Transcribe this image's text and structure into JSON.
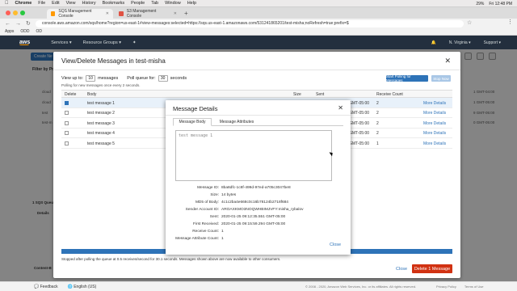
{
  "menubar": {
    "apple": "",
    "items": [
      "Chrome",
      "File",
      "Edit",
      "View",
      "History",
      "Bookmarks",
      "People",
      "Tab",
      "Window",
      "Help"
    ],
    "battery": "29%",
    "clock": "Fri 12:48 PM"
  },
  "tabs": [
    {
      "label": "SQS Management Console",
      "active": true
    },
    {
      "label": "S3 Management Console",
      "active": false
    }
  ],
  "address": {
    "url": "console.aws.amazon.com/sqs/home?region=us-east-1#view-messages:selected=https://sqs.us-east-1.amazonaws.com/531241865201/test-misha;noRefresh=true;prefix=$"
  },
  "bookmarks": [
    "Apps",
    "ODD",
    "OD"
  ],
  "awsnav": {
    "logo": "aws",
    "services": "Services ▾",
    "resource_groups": "Resource Groups ▾",
    "region": "N. Virginia ▾",
    "support": "Support ▾"
  },
  "bgpage": {
    "create_button": "Create Ne",
    "filter": "Filter by Pr",
    "rows": [
      "cloud",
      "cloud",
      "test",
      "test-m"
    ],
    "dates": [
      "1 GMT-04:00",
      "1 GMT-05:00",
      "9 GMT-05:00",
      "0 GMT-05:00"
    ],
    "selected": "1 SQS Queue",
    "details": "Details",
    "content": "Content-B"
  },
  "main_modal": {
    "title": "View/Delete Messages in test-misha",
    "view_up_to": "View up to:",
    "view_up_to_value": "10",
    "messages": "messages",
    "poll_queue": "Poll queue for:",
    "poll_value": "30",
    "seconds": "seconds",
    "poll_note": "Polling for new messages once every 2 seconds.",
    "start_button": "Start Polling for Messages",
    "stop_button": "Stop Now",
    "headers": {
      "delete": "Delete",
      "body": "Body",
      "size": "Size",
      "sent": "Sent",
      "receive_count": "Receive Count"
    },
    "rows": [
      {
        "body": "test message 1",
        "sent": "GMT-05:00",
        "count": "2",
        "link": "More Details",
        "checked": true
      },
      {
        "body": "test message 2",
        "sent": "GMT-05:00",
        "count": "2",
        "link": "More Details",
        "checked": false
      },
      {
        "body": "test message 3",
        "sent": "GMT-05:00",
        "count": "2",
        "link": "More Details",
        "checked": false
      },
      {
        "body": "test message 4",
        "sent": "GMT-05:00",
        "count": "2",
        "link": "More Details",
        "checked": false
      },
      {
        "body": "test message 5",
        "sent": "GMT-05:00",
        "count": "1",
        "link": "More Details",
        "checked": false
      }
    ],
    "stopped_note": "Stopped after polling the queue at 0.5 receives/second for 30.1 seconds. Messages shown above are now available to other consumers.",
    "close": "Close",
    "delete_button": "Delete 1 Message"
  },
  "detail_modal": {
    "title": "Message Details",
    "tab_body": "Message Body",
    "tab_attributes": "Message Attributes",
    "body_text": "test message 1",
    "fields": [
      {
        "k": "Message ID:",
        "v": "8ba8dfc-1c8f-499d-97ed-a705c3047be8"
      },
      {
        "k": "Size:",
        "v": "14 bytes"
      },
      {
        "k": "MD5 of Body:",
        "v": "4c1c2ba4e668c0c16b78124b2718f684"
      },
      {
        "k": "Sender Account ID:",
        "v": "AROAXKMO3NOQWHBIMJVFY:misha_rybalov"
      },
      {
        "k": "Sent:",
        "v": "2020-01-25 09:12:35.551 GMT-05:00"
      },
      {
        "k": "First Received:",
        "v": "2020-01-25 09:15:59.294 GMT-05:00"
      },
      {
        "k": "Receive Count:",
        "v": "1"
      },
      {
        "k": "Message Attribute Count:",
        "v": "1"
      }
    ],
    "close": "Close"
  },
  "footer": {
    "feedback": "Feedback",
    "language": "English (US)",
    "copyright": "© 2008 - 2020, Amazon Web Services, Inc. or its affiliates. All rights reserved.",
    "privacy": "Privacy Policy",
    "terms": "Terms of Use"
  }
}
